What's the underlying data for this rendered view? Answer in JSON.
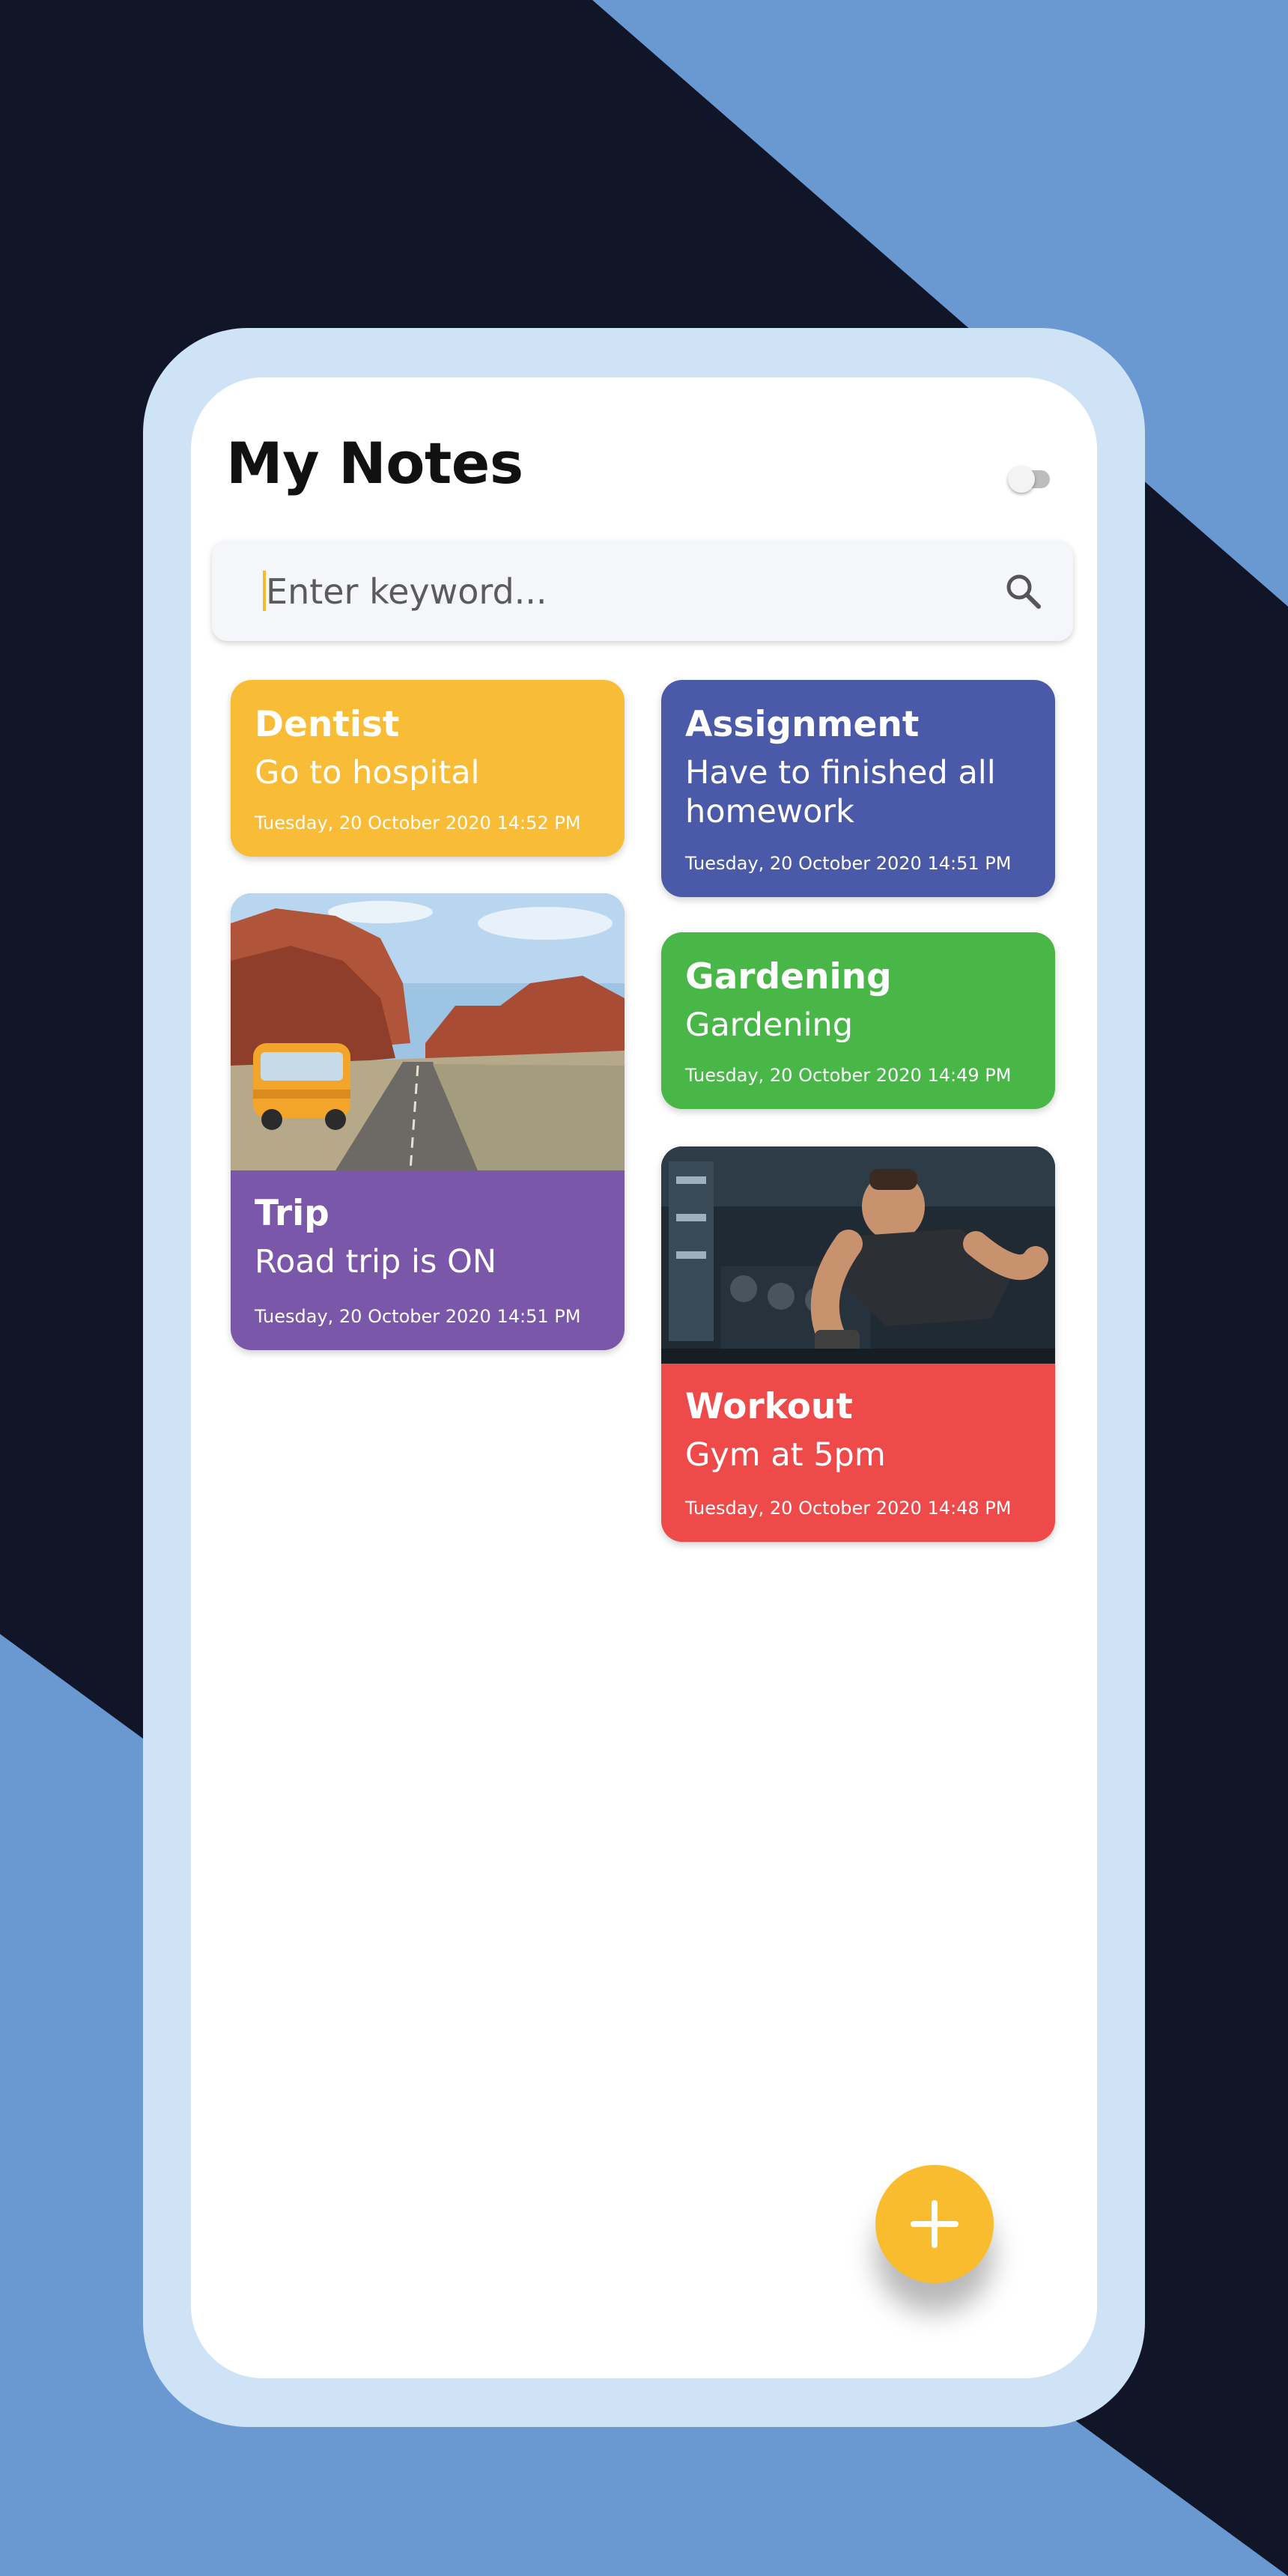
{
  "app": {
    "title": "My Notes",
    "theme_toggle_on": false
  },
  "search": {
    "placeholder": "Enter keyword..."
  },
  "colors": {
    "background_dark": "#101628",
    "background_accent": "#6a98d1",
    "frame": "#cfe3f7",
    "fab": "#f9bc2e"
  },
  "notes": [
    {
      "id": "dentist",
      "title": "Dentist",
      "text": "Go to hospital",
      "date": "Tuesday, 20 October 2020 14:52 PM",
      "color": "#f9bc36",
      "image": "none"
    },
    {
      "id": "assignment",
      "title": "Assignment",
      "text": "Have to finished all homework",
      "date": "Tuesday, 20 October 2020 14:51 PM",
      "color": "#4b5aa8",
      "image": "none"
    },
    {
      "id": "trip",
      "title": "Trip",
      "text": "Road trip is ON",
      "date": "Tuesday, 20 October 2020 14:51 PM",
      "color": "#7a57a8",
      "image": "desert-road-van-photo"
    },
    {
      "id": "gardening",
      "title": "Gardening",
      "text": "Gardening",
      "date": "Tuesday, 20 October 2020 14:49 PM",
      "color": "#48b748",
      "image": "none"
    },
    {
      "id": "workout",
      "title": "Workout",
      "text": "Gym at 5pm",
      "date": "Tuesday, 20 October 2020 14:48 PM",
      "color": "#ee4a4a",
      "image": "gym-dumbbell-photo"
    }
  ],
  "fab": {
    "icon": "plus-icon"
  }
}
